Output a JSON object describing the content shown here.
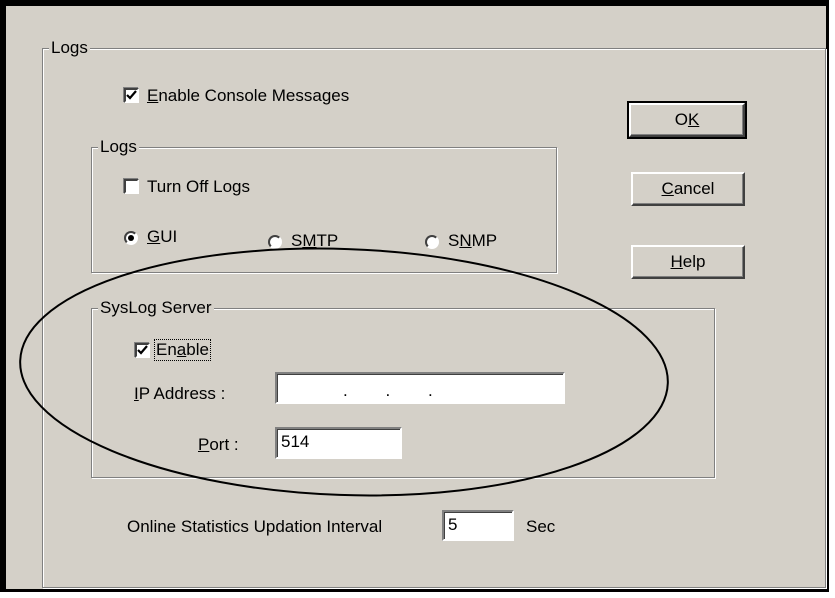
{
  "dialog": {
    "outer_group_label": "Logs",
    "console_messages": {
      "label_pre": "",
      "label_ul": "E",
      "label_post": "nable Console Messages",
      "checked": true
    },
    "logs_group": {
      "label": "Logs",
      "turn_off_logs": {
        "label": "Turn Off Logs",
        "checked": false
      },
      "radios": [
        {
          "pre": "",
          "ul": "G",
          "post": "UI",
          "selected": true
        },
        {
          "pre": "S",
          "ul": "M",
          "post": "TP",
          "selected": false
        },
        {
          "pre": "S",
          "ul": "N",
          "post": "MP",
          "selected": false
        }
      ]
    },
    "syslog_group": {
      "label": "SysLog Server",
      "enable": {
        "pre": "En",
        "ul": "a",
        "post": "ble",
        "checked": true
      },
      "ip_label": {
        "ul": "I",
        "post": "P Address :"
      },
      "ip_dots": ".        .        .",
      "port_label": {
        "ul": "P",
        "post": "ort :"
      },
      "port_value": "514"
    },
    "stats": {
      "label": "Online Statistics Updation Interval",
      "value": "5",
      "unit": "Sec"
    },
    "buttons": {
      "ok": {
        "pre": "O",
        "ul": "K",
        "post": ""
      },
      "cancel": {
        "pre": "",
        "ul": "C",
        "post": "ancel"
      },
      "help": {
        "pre": "",
        "ul": "H",
        "post": "elp"
      }
    }
  }
}
